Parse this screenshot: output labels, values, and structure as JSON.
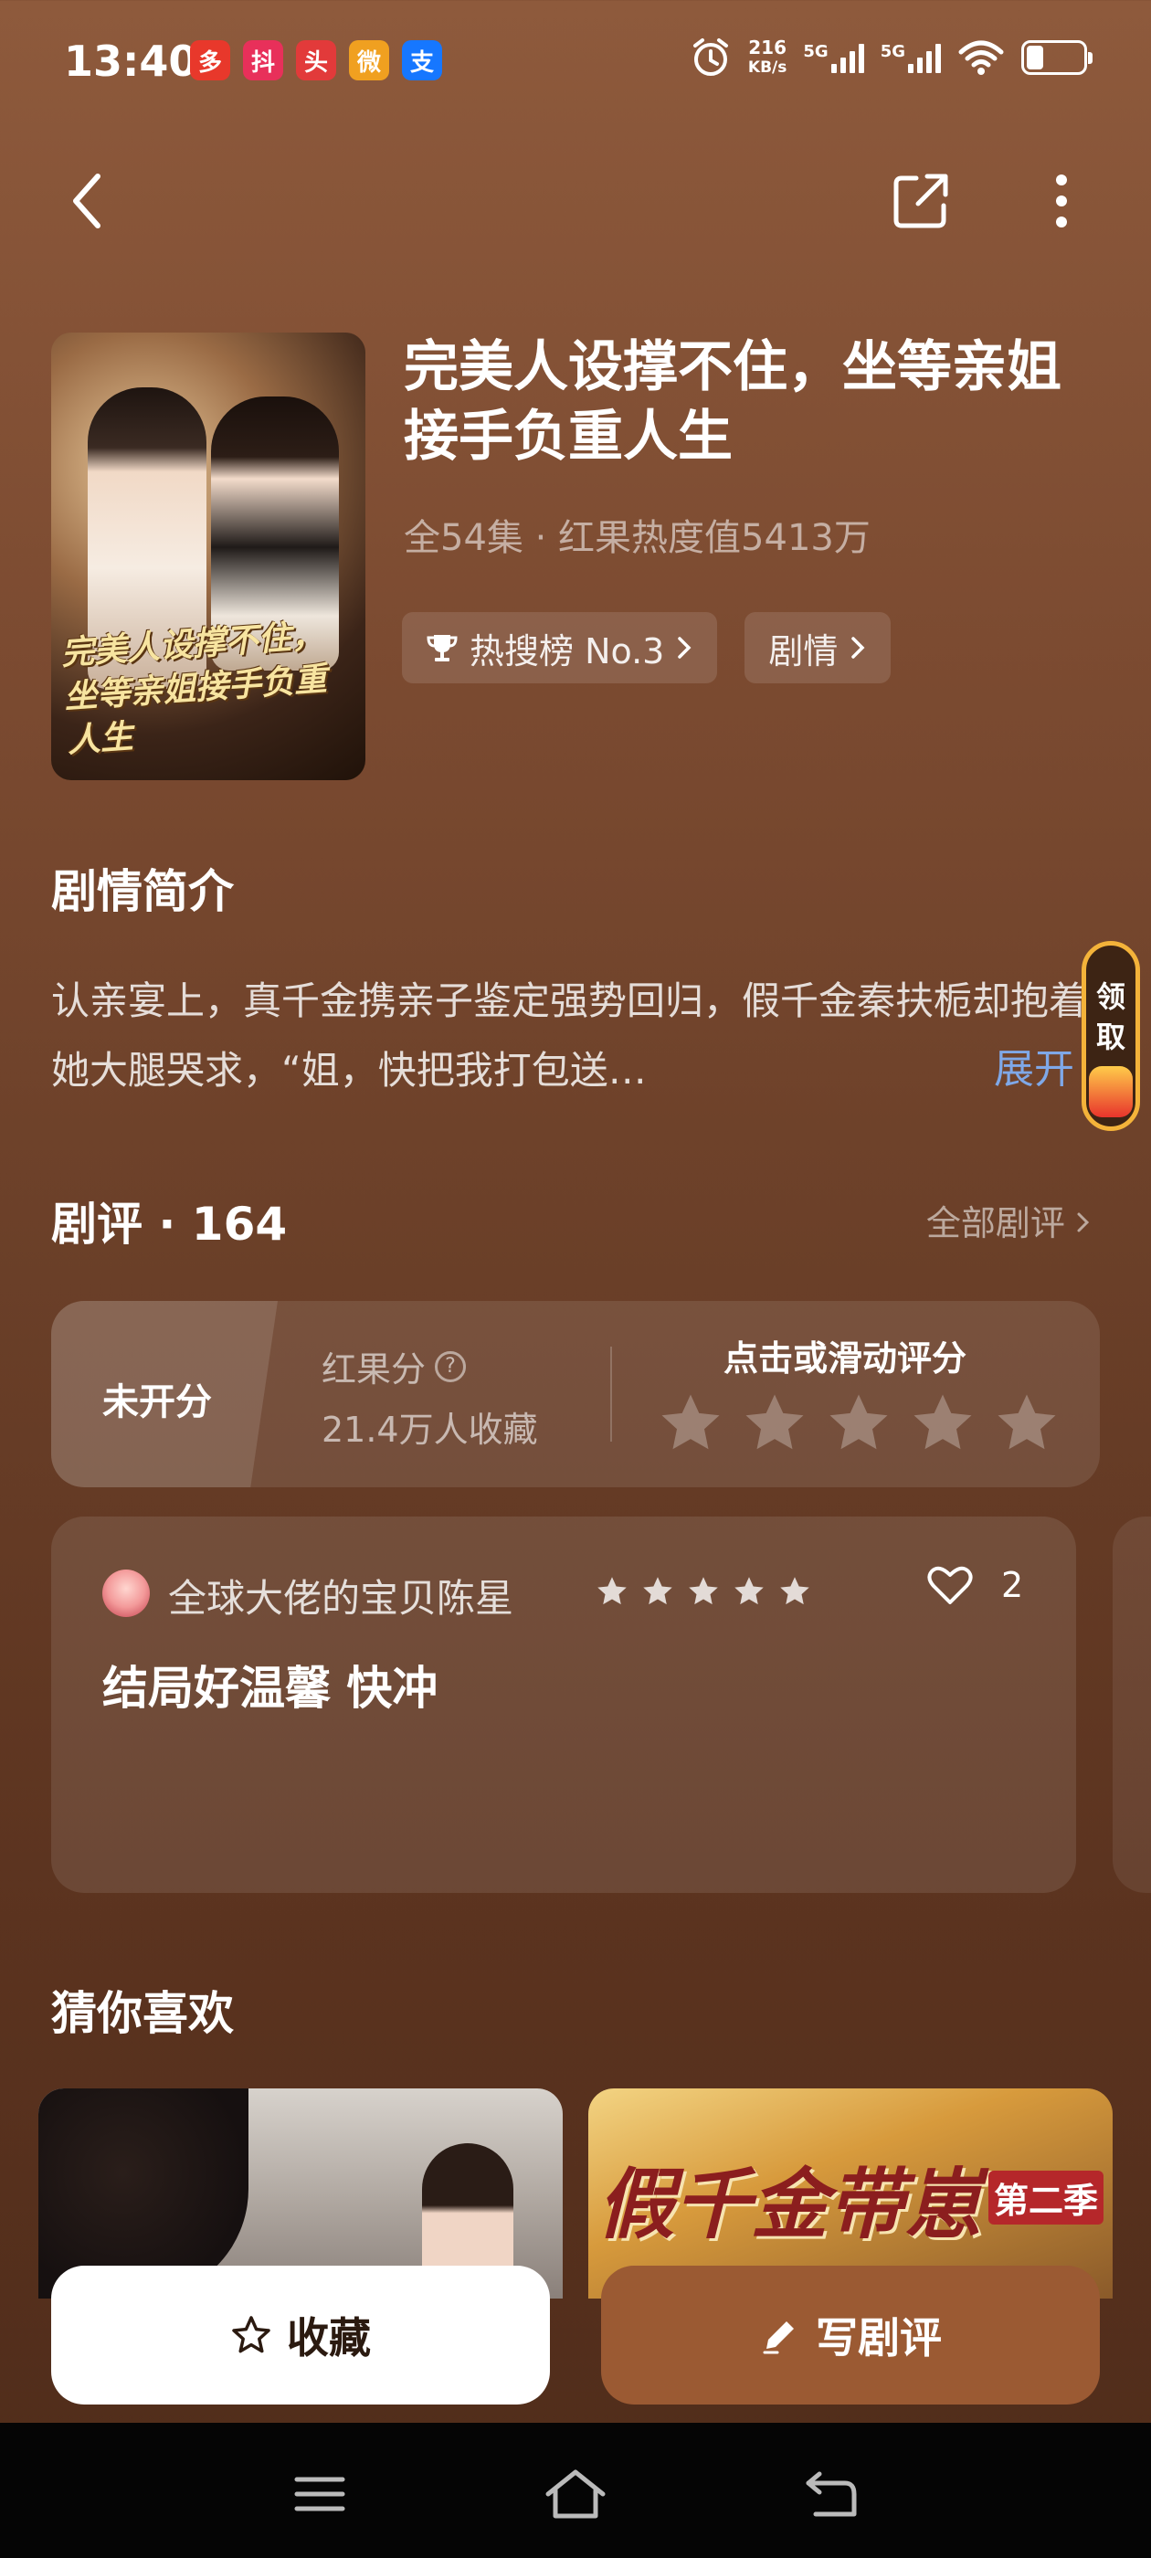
{
  "status_bar": {
    "time": "13:40",
    "app_icons": [
      {
        "name": "pinduoduo-icon",
        "glyph": "多",
        "color": "#e8382b"
      },
      {
        "name": "douyin-icon",
        "glyph": "抖",
        "color": "#e8305a"
      },
      {
        "name": "toutiao-icon",
        "glyph": "头",
        "color": "#e23a3a"
      },
      {
        "name": "weibo-icon",
        "glyph": "微",
        "color": "#f0a020"
      },
      {
        "name": "alipay-icon",
        "glyph": "支",
        "color": "#1677ff"
      }
    ],
    "net_speed_value": "216",
    "net_speed_unit": "KB/s",
    "sim1_label": "5G",
    "sim2_label": "5G"
  },
  "drama": {
    "title": "完美人设撑不住，坐等亲姐接手负重人生",
    "poster_title": "完美人设撑不住，坐等亲姐接手负重人生",
    "meta": "全54集 · 红果热度值5413万",
    "tags": [
      {
        "label": "热搜榜 No.3",
        "icon": "trophy-icon"
      },
      {
        "label": "剧情",
        "icon": null
      }
    ]
  },
  "synopsis": {
    "heading": "剧情简介",
    "text": "认亲宴上，真千金携亲子鉴定强势回归，假千金秦扶栀却抱着她大腿哭求，“姐，快把我打包送…",
    "expand_label": "展开"
  },
  "float_badge": {
    "line1": "领",
    "line2": "取"
  },
  "reviews": {
    "heading": "剧评 · 164",
    "all_label": "全部剧评",
    "rating": {
      "status": "未开分",
      "label": "红果分",
      "help_glyph": "?",
      "favorites": "21.4万人收藏",
      "prompt": "点击或滑动评分",
      "star_count": 5
    },
    "items": [
      {
        "user": "全球大佬的宝贝陈星",
        "stars": 5,
        "likes": "2",
        "text": "结局好温馨 快冲"
      }
    ]
  },
  "recommend": {
    "heading": "猜你喜欢",
    "items": [
      {
        "title": ""
      },
      {
        "title": "假千金带崽",
        "season": "第二季"
      }
    ]
  },
  "actions": {
    "favorite_label": "收藏",
    "write_review_label": "写剧评"
  },
  "colors": {
    "accent_brown": "#9b5a33",
    "expand_link": "#7fa8e8",
    "badge_border": "#f4b33a"
  }
}
